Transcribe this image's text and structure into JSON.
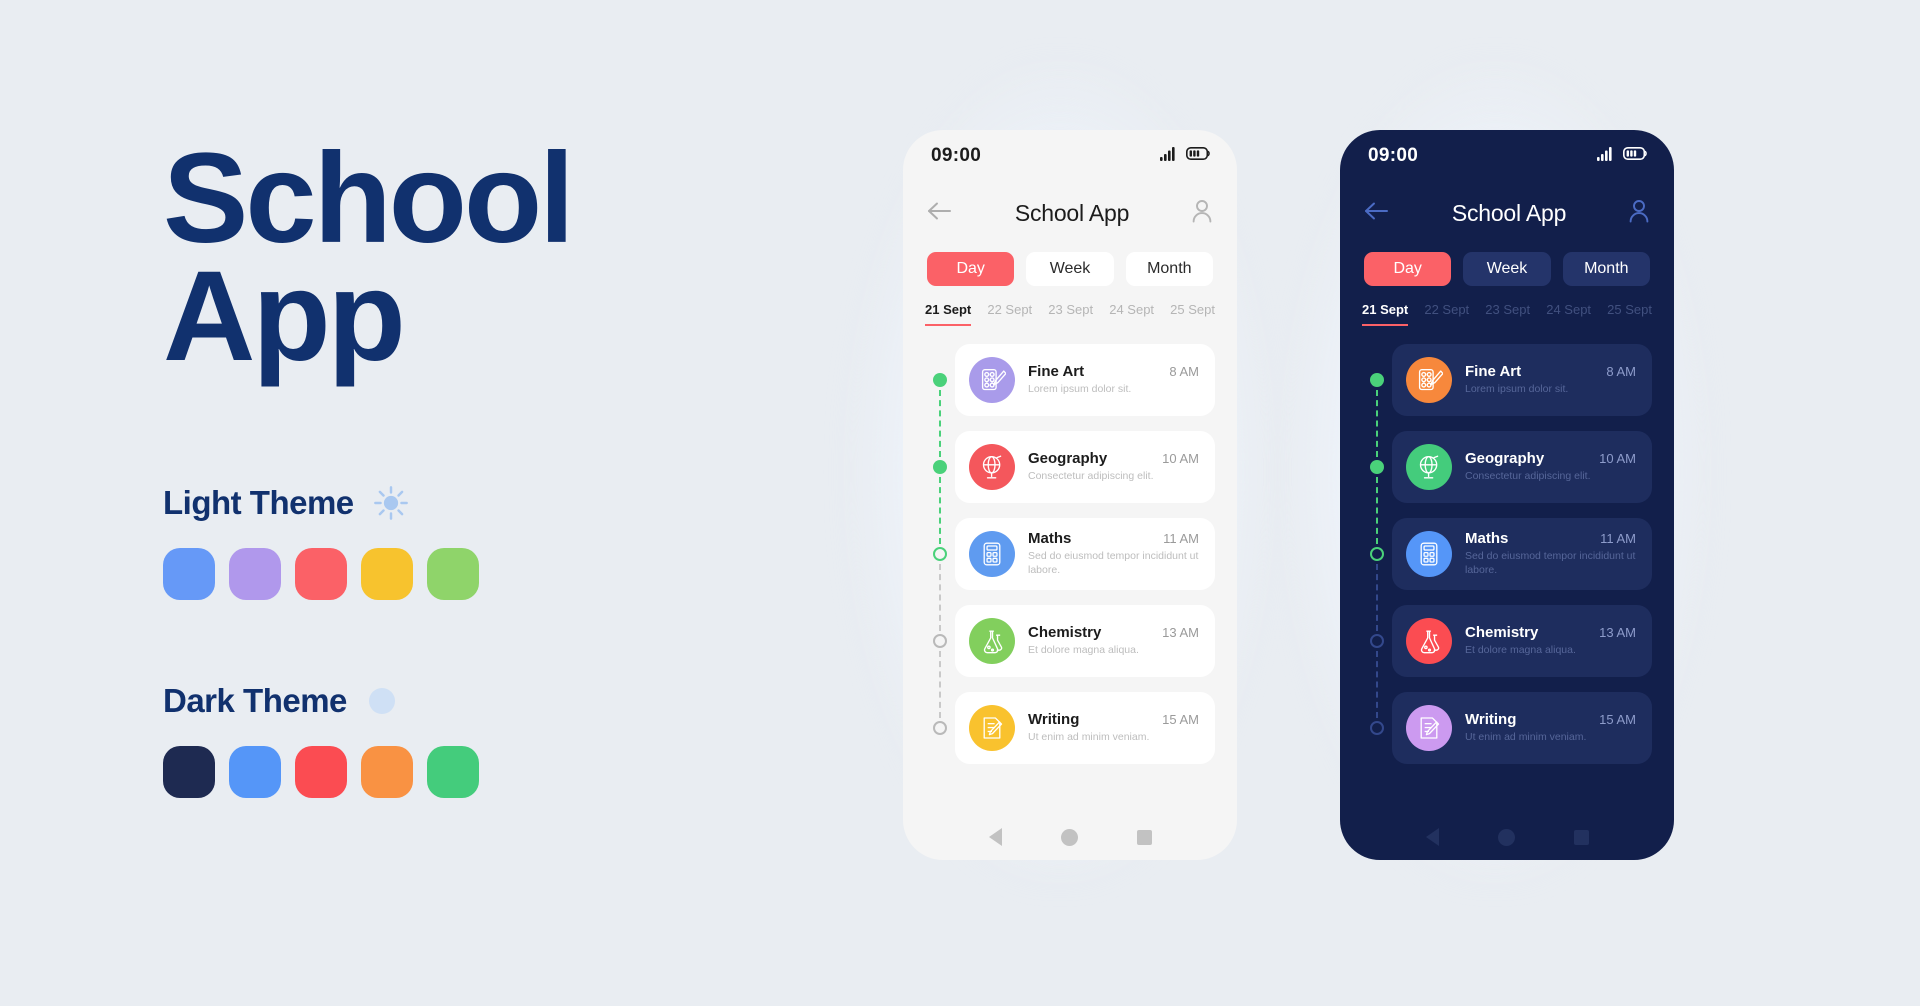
{
  "hero": {
    "line1": "School",
    "line2": "App"
  },
  "themes": [
    {
      "id": "light",
      "label": "Light Theme",
      "icon": "sun-icon",
      "icon_color": "#a9c8f0",
      "swatches": [
        "#6699f7",
        "#b098ec",
        "#fb6167",
        "#f7c32e",
        "#8fd46a"
      ]
    },
    {
      "id": "dark",
      "label": "Dark Theme",
      "icon": "moon-icon",
      "icon_color": "#cfe0f5",
      "swatches": [
        "#1e2a51",
        "#5596f8",
        "#fb4c52",
        "#f99243",
        "#44cc7c"
      ]
    }
  ],
  "phones": [
    {
      "id": "light",
      "status": {
        "time": "09:00",
        "signal_icon": "signal-bars-icon",
        "battery_icon": "battery-icon"
      },
      "appbar": {
        "back_icon": "arrow-left-icon",
        "title": "School App",
        "profile_icon": "user-icon"
      },
      "segments": [
        {
          "label": "Day",
          "active": true
        },
        {
          "label": "Week",
          "active": false
        },
        {
          "label": "Month",
          "active": false
        }
      ],
      "dates": [
        {
          "label": "21 Sept",
          "active": true
        },
        {
          "label": "22 Sept",
          "active": false
        },
        {
          "label": "23 Sept",
          "active": false
        },
        {
          "label": "24 Sept",
          "active": false
        },
        {
          "label": "25 Sept",
          "active": false
        }
      ],
      "lessons": [
        {
          "title": "Fine Art",
          "time": "8 AM",
          "subtitle": "Lorem ipsum dolor sit.",
          "icon": "paint-palette-icon",
          "icon_bg": "#a99bea",
          "marker": "filled"
        },
        {
          "title": "Geography",
          "time": "10 AM",
          "subtitle": "Consectetur adipiscing elit.",
          "icon": "globe-icon",
          "icon_bg": "#f4575c",
          "marker": "filled"
        },
        {
          "title": "Maths",
          "time": "11 AM",
          "subtitle": "Sed do eiusmod tempor incididunt ut labore.",
          "icon": "calculator-icon",
          "icon_bg": "#5f9bf0",
          "marker": "ring-green"
        },
        {
          "title": "Chemistry",
          "time": "13 AM",
          "subtitle": "Et dolore magna aliqua.",
          "icon": "flask-icon",
          "icon_bg": "#82cf5d",
          "marker": "ring"
        },
        {
          "title": "Writing",
          "time": "15 AM",
          "subtitle": "Ut enim ad minim veniam.",
          "icon": "note-pencil-icon",
          "icon_bg": "#f9c22e",
          "marker": "ring"
        }
      ],
      "navbar": {
        "back_icon": "nav-back-triangle-icon",
        "home_icon": "nav-home-circle-icon",
        "recents_icon": "nav-recents-square-icon"
      }
    },
    {
      "id": "dark",
      "status": {
        "time": "09:00",
        "signal_icon": "signal-bars-icon",
        "battery_icon": "battery-icon"
      },
      "appbar": {
        "back_icon": "arrow-left-icon",
        "title": "School App",
        "profile_icon": "user-icon"
      },
      "segments": [
        {
          "label": "Day",
          "active": true
        },
        {
          "label": "Week",
          "active": false
        },
        {
          "label": "Month",
          "active": false
        }
      ],
      "dates": [
        {
          "label": "21 Sept",
          "active": true
        },
        {
          "label": "22 Sept",
          "active": false
        },
        {
          "label": "23 Sept",
          "active": false
        },
        {
          "label": "24 Sept",
          "active": false
        },
        {
          "label": "25 Sept",
          "active": false
        }
      ],
      "lessons": [
        {
          "title": "Fine Art",
          "time": "8 AM",
          "subtitle": "Lorem ipsum dolor sit.",
          "icon": "paint-palette-icon",
          "icon_bg": "#f7883c",
          "marker": "filled"
        },
        {
          "title": "Geography",
          "time": "10 AM",
          "subtitle": "Consectetur adipiscing elit.",
          "icon": "globe-icon",
          "icon_bg": "#44cc7c",
          "marker": "filled"
        },
        {
          "title": "Maths",
          "time": "11 AM",
          "subtitle": "Sed do eiusmod tempor incididunt ut labore.",
          "icon": "calculator-icon",
          "icon_bg": "#5596f8",
          "marker": "ring-green"
        },
        {
          "title": "Chemistry",
          "time": "13 AM",
          "subtitle": "Et dolore magna aliqua.",
          "icon": "flask-icon",
          "icon_bg": "#fb4c52",
          "marker": "ring"
        },
        {
          "title": "Writing",
          "time": "15 AM",
          "subtitle": "Ut enim ad minim veniam.",
          "icon": "note-pencil-icon",
          "icon_bg": "#cc9af0",
          "marker": "ring"
        }
      ],
      "navbar": {
        "back_icon": "nav-back-triangle-icon",
        "home_icon": "nav-home-circle-icon",
        "recents_icon": "nav-recents-square-icon"
      }
    }
  ],
  "colors": {
    "background": "#e9edf2",
    "brand_navy": "#11316e",
    "accent_red": "#fb6167",
    "timeline_green": "#4ad17a",
    "light_phone_bg": "#f5f5f5",
    "dark_phone_bg": "#121f4b",
    "dark_card_bg": "#1e2d5e"
  }
}
